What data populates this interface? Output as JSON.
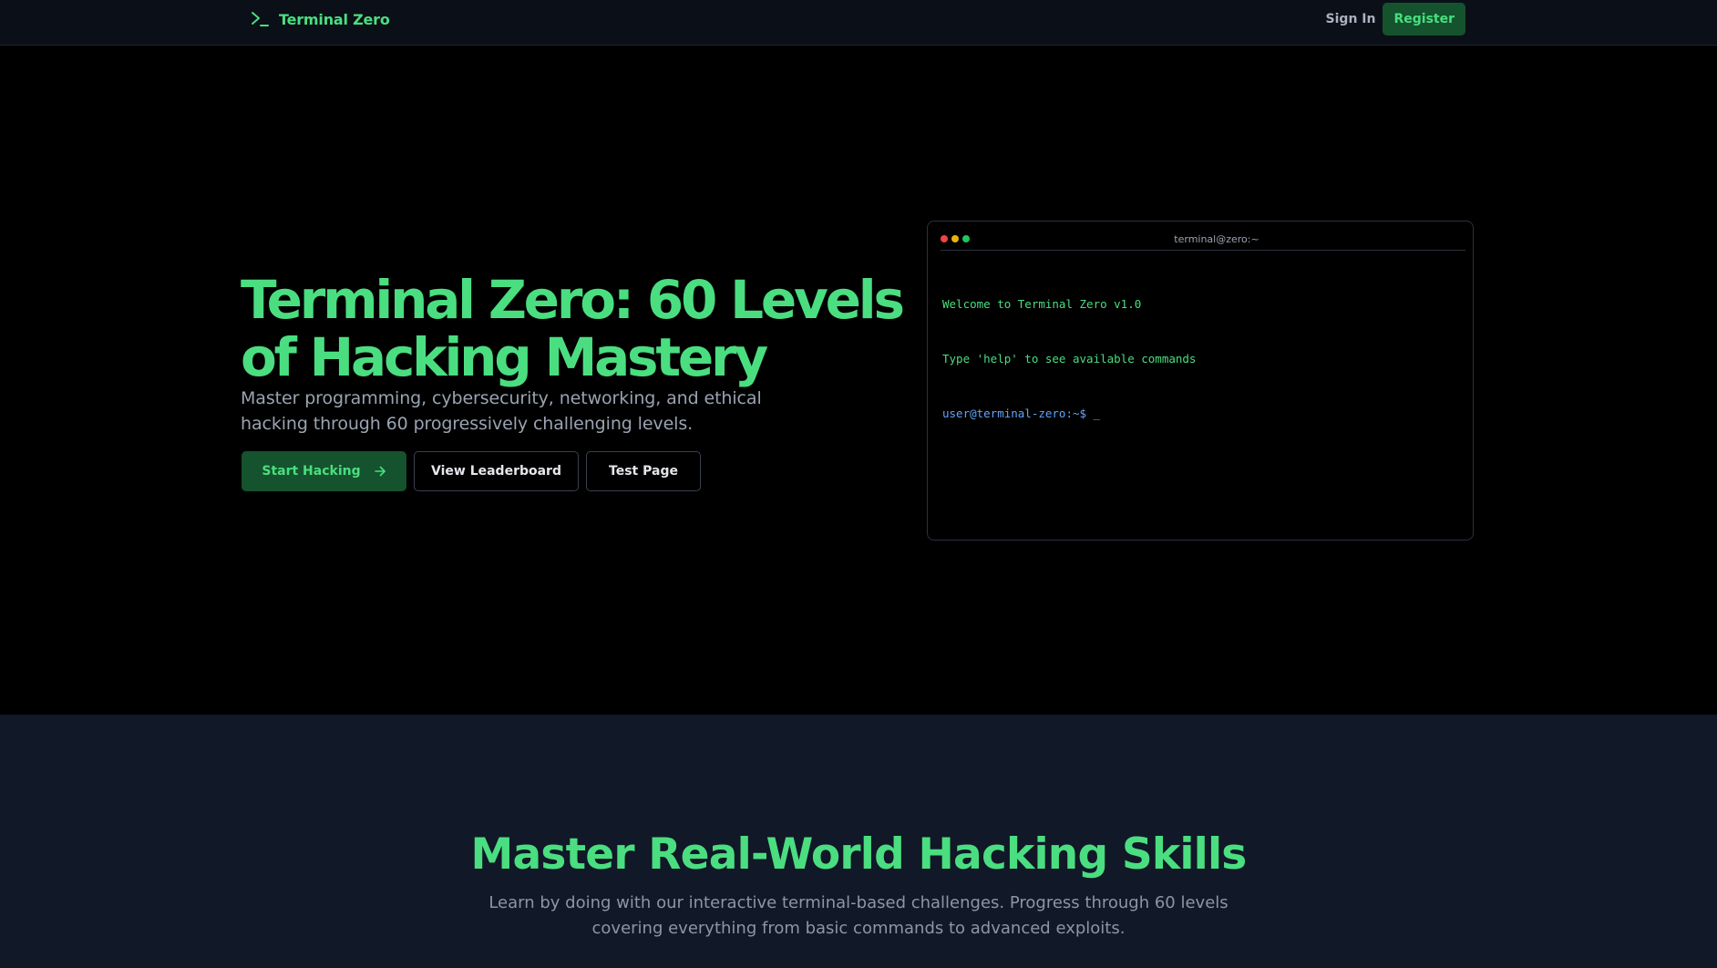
{
  "header": {
    "brand_name": "Terminal Zero",
    "brand_icon": "terminal-prompt-icon",
    "sign_in_label": "Sign In",
    "register_label": "Register"
  },
  "hero": {
    "title": "Terminal Zero: 60 Levels of Hacking Mastery",
    "subtitle": "Master programming, cybersecurity, networking, and ethical hacking through 60 progressively challenging levels.",
    "start_button_label": "Start Hacking",
    "start_button_icon": "arrow-right-icon",
    "leaderboard_button_label": "View Leaderboard",
    "test_button_label": "Test Page"
  },
  "terminal": {
    "window_title": "terminal@zero:~",
    "lines": [
      "Welcome to Terminal Zero v1.0",
      "Type 'help' to see available commands"
    ],
    "prompt": "user@terminal-zero:~$",
    "cursor": "_"
  },
  "features": {
    "title": "Master Real-World Hacking Skills",
    "subtitle": "Learn by doing with our interactive terminal-based challenges. Progress through 60 levels covering everything from basic commands to advanced exploits."
  },
  "colors": {
    "accent": "#4ade80",
    "accent_dark": "#14532d",
    "background": "#000000",
    "header_bg": "#0b0f17",
    "section_bg": "#111827",
    "prompt": "#60a5fa"
  }
}
